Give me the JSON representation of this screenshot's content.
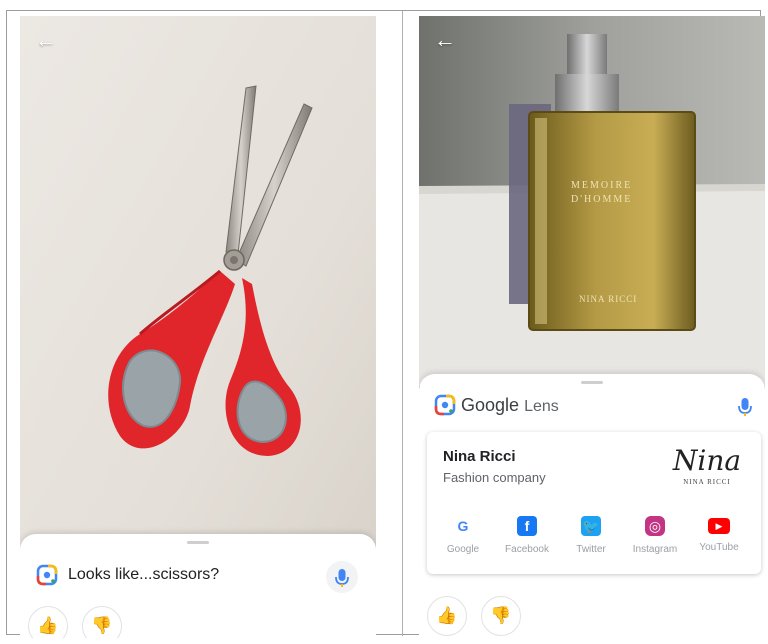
{
  "left_screen": {
    "back_icon": "arrow-left",
    "query_text": "Looks like...scissors?",
    "feedback": {
      "thumbs_up_icon": "thumbs-up",
      "thumbs_down_icon": "thumbs-down"
    }
  },
  "right_screen": {
    "back_icon": "arrow-left",
    "lens_header": {
      "google": "Google",
      "lens": "Lens"
    },
    "result": {
      "title": "Nina Ricci",
      "subtitle": "Fashion company",
      "logo_script": "Nina",
      "logo_caption": "NINA RICCI"
    },
    "product_label_top": "MEMOIRE",
    "product_label_mid": "D'HOMME",
    "product_label_bottom": "NINA RICCI",
    "links": [
      {
        "label": "Google",
        "icon": "google-g-icon",
        "color": "#4285f4"
      },
      {
        "label": "Facebook",
        "icon": "facebook-icon",
        "color": "#1877f2"
      },
      {
        "label": "Twitter",
        "icon": "twitter-icon",
        "color": "#1da1f2"
      },
      {
        "label": "Instagram",
        "icon": "instagram-icon",
        "color": "#c13584"
      },
      {
        "label": "YouTube",
        "icon": "youtube-icon",
        "color": "#ff0000"
      }
    ],
    "feedback": {
      "thumbs_up_icon": "thumbs-up",
      "thumbs_down_icon": "thumbs-down"
    }
  },
  "colors": {
    "lens_blue": "#4285f4",
    "scissor_red": "#e0252b",
    "mic_blue": "#4285f4",
    "mic_yellow": "#fbbc04"
  }
}
